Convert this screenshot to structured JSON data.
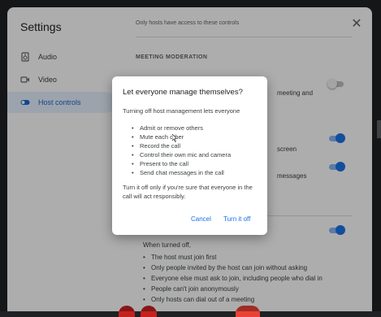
{
  "settings": {
    "title": "Settings",
    "nav": [
      {
        "label": "Audio",
        "icon": "speaker-icon"
      },
      {
        "label": "Video",
        "icon": "video-camera-icon"
      },
      {
        "label": "Host controls",
        "icon": "toggle-icon",
        "active": true
      }
    ],
    "notice": "Only hosts have access to these controls",
    "section_header": "MEETING MODERATION",
    "fragments": {
      "meeting_and": "meeting and",
      "screen": "screen",
      "messages": "messages"
    },
    "toggles": [
      {
        "name": "host-management-toggle",
        "on": false
      },
      {
        "name": "screen-share-toggle",
        "on": true
      },
      {
        "name": "chat-messages-toggle",
        "on": true
      },
      {
        "name": "quick-access-toggle",
        "on": true
      }
    ],
    "when_turned_off": "When turned off,",
    "quick_access_bullets": [
      "The host must join first",
      "Only people invited by the host can join without asking",
      "Everyone else must ask to join, including people who dial in",
      "People can't join anonymously",
      "Only hosts can dial out of a meeting"
    ]
  },
  "dialog": {
    "title": "Let everyone manage themselves?",
    "intro": "Turning off host management lets everyone",
    "bullets": [
      "Admit or remove others",
      "Mute each other",
      "Record the call",
      "Control their own mic and camera",
      "Present to the call",
      "Send chat messages in the call"
    ],
    "warning": "Turn it off only if you're sure that everyone in the call will act responsibly.",
    "cancel_label": "Cancel",
    "confirm_label": "Turn it off"
  },
  "colors": {
    "accent": "#1a73e8",
    "scrim": "rgba(0,0,0,0.32)",
    "background": "#202124",
    "leave_call": "#ea4335"
  }
}
